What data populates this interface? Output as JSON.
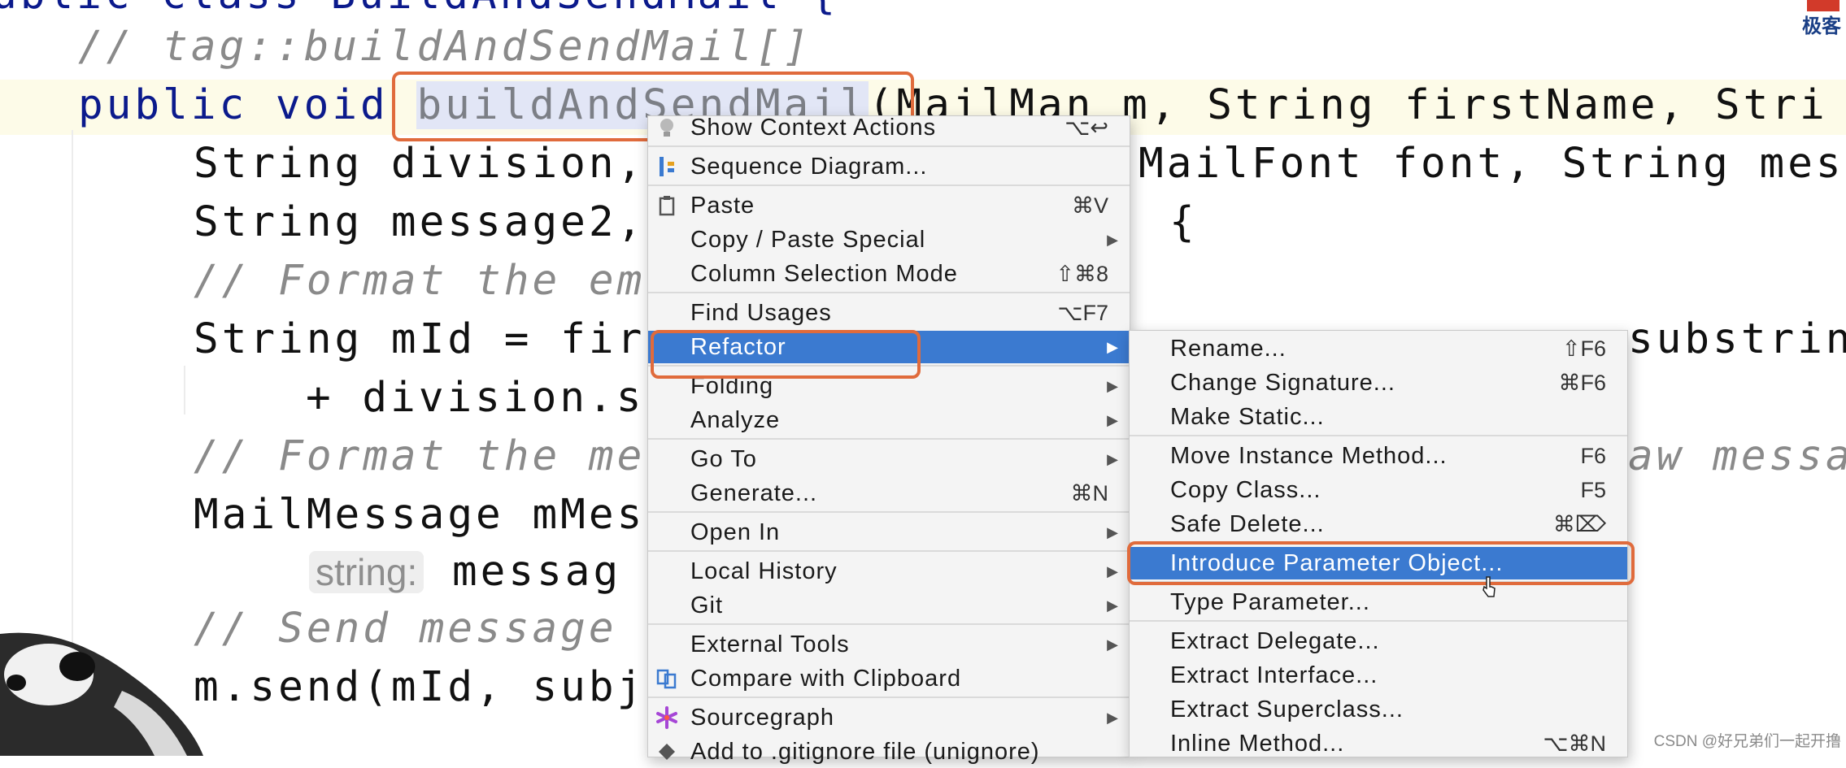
{
  "code": {
    "line0": "ublic class BuildAndSendMail {",
    "line1": "// tag::buildAndSendMail[]",
    "line2": {
      "kw": "public void ",
      "name": "buildAndSendMail",
      "rest": "(MailMan m, String firstName, Stri"
    },
    "line3a": "String division,",
    "line3b": "MailFont font, String mes",
    "line4a": "String message2,",
    "line4b": "{",
    "line5": "// Format the em",
    "line6a": "String mId = fir",
    "line6b": "substrin",
    "line7": "+ division.s",
    "line8a": "// Format the me",
    "line8b": "aw messa",
    "line9": "MailMessage mMes",
    "line10": {
      "hint": "string:",
      "rest": " messag"
    },
    "line11": "// Send message",
    "line12": "m.send(mId, subj"
  },
  "context_menu": {
    "items": [
      {
        "label": "Show Context Actions",
        "shortcut": "⌥↩",
        "icon": "bulb-icon"
      },
      {
        "label": "Sequence Diagram...",
        "icon": "sequence-icon"
      },
      {
        "label": "Paste",
        "shortcut": "⌘V",
        "icon": "clipboard-icon"
      },
      {
        "label": "Copy / Paste Special"
      },
      {
        "label": "Column Selection Mode",
        "shortcut": "⇧⌘8"
      },
      {
        "label": "Find Usages",
        "shortcut": "⌥F7"
      },
      {
        "label": "Refactor"
      },
      {
        "label": "Folding"
      },
      {
        "label": "Analyze"
      },
      {
        "label": "Go To"
      },
      {
        "label": "Generate...",
        "shortcut": "⌘N"
      },
      {
        "label": "Open In"
      },
      {
        "label": "Local History"
      },
      {
        "label": "Git"
      },
      {
        "label": "External Tools"
      },
      {
        "label": "Compare with Clipboard",
        "icon": "compare-icon"
      },
      {
        "label": "Sourcegraph",
        "icon": "sourcegraph-icon"
      },
      {
        "label": "Add to .gitignore file (unignore)",
        "icon": "gitignore-icon"
      }
    ]
  },
  "refactor_menu": {
    "items": [
      {
        "label": "Rename...",
        "shortcut": "⇧F6"
      },
      {
        "label": "Change Signature...",
        "shortcut": "⌘F6"
      },
      {
        "label": "Make Static..."
      },
      {
        "label": "Move Instance Method...",
        "shortcut": "F6"
      },
      {
        "label": "Copy Class...",
        "shortcut": "F5"
      },
      {
        "label": "Safe Delete...",
        "shortcut": "⌘⌦"
      },
      {
        "label": "Introduce Parameter Object..."
      },
      {
        "label": "Type Parameter..."
      },
      {
        "label": "Extract Delegate..."
      },
      {
        "label": "Extract Interface..."
      },
      {
        "label": "Extract Superclass..."
      },
      {
        "label": "Inline Method...",
        "shortcut": "⌥⌘N"
      }
    ]
  },
  "colors": {
    "selection": "#3b7ad0",
    "annotation": "#e06b3c",
    "keyword": "#0b1a8c"
  },
  "watermark": "CSDN @好兄弟们一起开撸",
  "logo_text": "极客"
}
